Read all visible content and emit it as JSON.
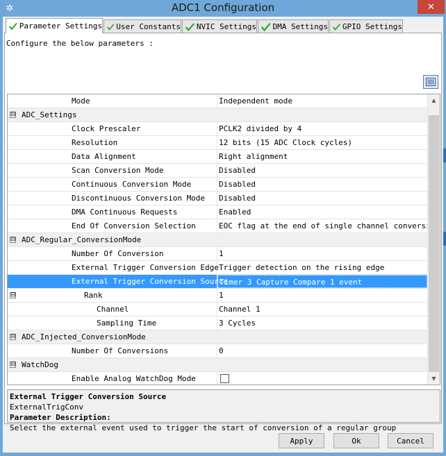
{
  "window": {
    "title": "ADC1 Configuration",
    "close_label": "✕"
  },
  "tabs": [
    {
      "label": "Parameter Settings",
      "active": true
    },
    {
      "label": "User Constants",
      "active": false
    },
    {
      "label": "NVIC Settings",
      "active": false
    },
    {
      "label": "DMA Settings",
      "active": false
    },
    {
      "label": "GPIO Settings",
      "active": false
    }
  ],
  "panel": {
    "instruction": "Configure the below parameters :"
  },
  "grid": {
    "rows": [
      {
        "name": "Mode",
        "value": "Independent mode",
        "type": "item",
        "level": 1
      },
      {
        "name": "ADC_Settings",
        "value": "",
        "type": "group",
        "level": 0,
        "expander": "⊟"
      },
      {
        "name": "Clock Prescaler",
        "value": "PCLK2 divided by 4",
        "type": "item",
        "level": 1
      },
      {
        "name": "Resolution",
        "value": "12 bits (15 ADC Clock cycles)",
        "type": "item",
        "level": 1
      },
      {
        "name": "Data Alignment",
        "value": "Right alignment",
        "type": "item",
        "level": 1
      },
      {
        "name": "Scan Conversion Mode",
        "value": "Disabled",
        "type": "item",
        "level": 1
      },
      {
        "name": "Continuous Conversion Mode",
        "value": "Disabled",
        "type": "item",
        "level": 1
      },
      {
        "name": "Discontinuous Conversion Mode",
        "value": "Disabled",
        "type": "item",
        "level": 1
      },
      {
        "name": "DMA Continuous Requests",
        "value": "Enabled",
        "type": "item",
        "level": 1
      },
      {
        "name": "End Of Conversion Selection",
        "value": "EOC flag at the end of single channel conversion",
        "type": "item",
        "level": 1
      },
      {
        "name": "ADC_Regular_ConversionMode",
        "value": "",
        "type": "group",
        "level": 0,
        "expander": "⊟"
      },
      {
        "name": "Number Of Conversion",
        "value": "1",
        "type": "item",
        "level": 1
      },
      {
        "name": "External Trigger Conversion Edge",
        "value": "Trigger detection on the rising edge",
        "type": "item",
        "level": 1
      },
      {
        "name": "External Trigger Conversion Source",
        "value": "Timer 3 Capture Compare 1 event",
        "type": "item",
        "level": 1,
        "selected": true
      },
      {
        "name": "Rank",
        "value": "1",
        "type": "subgroup",
        "level": 2,
        "expander": "⊟"
      },
      {
        "name": "Channel",
        "value": "Channel 1",
        "type": "item",
        "level": 3
      },
      {
        "name": "Sampling Time",
        "value": "3 Cycles",
        "type": "item",
        "level": 3
      },
      {
        "name": "ADC_Injected_ConversionMode",
        "value": "",
        "type": "group",
        "level": 0,
        "expander": "⊟"
      },
      {
        "name": "Number Of Conversions",
        "value": "0",
        "type": "item",
        "level": 1
      },
      {
        "name": "WatchDog",
        "value": "",
        "type": "group",
        "level": 0,
        "expander": "⊟"
      },
      {
        "name": "Enable Analog WatchDog Mode",
        "value": "",
        "type": "checkbox",
        "level": 1,
        "checked": false
      }
    ]
  },
  "description": {
    "title": "External Trigger Conversion Source",
    "param_id": "ExternalTrigConv",
    "heading": "Parameter Description:",
    "text": "Select the external event used to trigger the start of conversion of a regular group"
  },
  "buttons": {
    "apply": "Apply",
    "ok": "Ok",
    "cancel": "Cancel"
  },
  "colors": {
    "selection": "#3399ff",
    "check": "#2ea82e",
    "title_bar": "#6fa8d8",
    "close": "#c7463b"
  },
  "icons": {
    "app": "app-icon",
    "tab_check": "check-icon",
    "view_toggle": "list-view-icon"
  }
}
